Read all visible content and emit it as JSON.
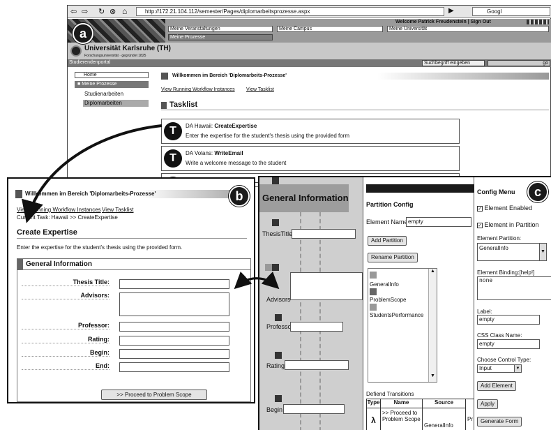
{
  "browser": {
    "url": "http://172.21.104.112/semester/Pages/diplomarbeitsprozesse.aspx",
    "search_placeholder": "Googl"
  },
  "portal": {
    "welcome": "Welcome Patrick Freudenstein | Sign Out",
    "menus": [
      "Meine Veranstaltungen",
      "Meine Campus",
      "Meine Universität"
    ],
    "active_menu": "Meine Prozesse",
    "university": "Universität Karlsruhe (TH)",
    "university_sub": "Forschungsuniversität · gegründet 1825",
    "portal_name": "Studierendenportal",
    "search_placeholder": "Suchbegriff eingeben",
    "search_go": "go"
  },
  "sidebar": {
    "home": "Home",
    "section": "Meine Prozesse",
    "items": [
      "Studienarbeiten",
      "Diplomarbeiten"
    ]
  },
  "main_a": {
    "banner": "Willkommen im Bereich 'Diplomarbeits-Prozesse'",
    "link1": "View Running Workflow Instances",
    "link2": "View Tasklist",
    "tasklist_title": "Tasklist",
    "tasks": [
      {
        "who": "DA Hawaii:",
        "name": "CreateExpertise",
        "desc": "Enter the expertise for the student's thesis using the provided form"
      },
      {
        "who": "DA Volans:",
        "name": "WriteEmail",
        "desc": "Write a welcome message to the student"
      }
    ]
  },
  "panel_b": {
    "banner": "Willkommen im Bereich 'Diplomarbeits-Prozesse'",
    "link1": "View Running Workflow Instances",
    "link2": "View Tasklist",
    "breadcrumb": "Current Task: Hawaii >> CreateExpertise",
    "title": "Create Expertise",
    "intro": "Enter the expertise for the student's thesis using the provided form.",
    "section": "General Information",
    "fields": [
      "Thesis Title:",
      "Advisors:",
      "Professor:",
      "Rating:",
      "Begin:",
      "End:"
    ],
    "proceed": ">> Proceed to Problem Scope"
  },
  "designer": {
    "header": "General Information",
    "field_labels": [
      "ThesisTitle",
      "Advisors",
      "Professor",
      "Rating",
      "Begin"
    ]
  },
  "partition": {
    "title": "Partition Config",
    "element_name_label": "Element Name",
    "element_name_value": "empty",
    "add_partition": "Add Partition",
    "rename_partition": "Rename Partition",
    "partitions": [
      "GeneralInfo",
      "ProblemScope",
      "StudentsPerformance"
    ],
    "transitions_title": "Defiend Transitions",
    "table_headers": [
      "Type",
      "Name",
      "Source"
    ],
    "table_row": {
      "type": "λ",
      "name": ">> Proceed to Problem Scope",
      "source": "GeneralInfo",
      "extra": "Pr"
    }
  },
  "config": {
    "title": "Config Menu",
    "check1": "Element Enabled",
    "check2": "Element in Partition",
    "partition_label": "Element Partition:",
    "partition_value": "GeneralInfo",
    "binding_label": "Element Binding:[help!]",
    "binding_value": "none",
    "label_label": "Label:",
    "label_value": "empty",
    "css_label": "CSS Class Name:",
    "css_value": "empty",
    "control_label": "Choose Control Type:",
    "control_value": "Input",
    "add_element": "Add Element",
    "apply": "Apply",
    "generate": "Generate Form"
  },
  "markers": {
    "a": "a",
    "b": "b",
    "c": "c"
  }
}
